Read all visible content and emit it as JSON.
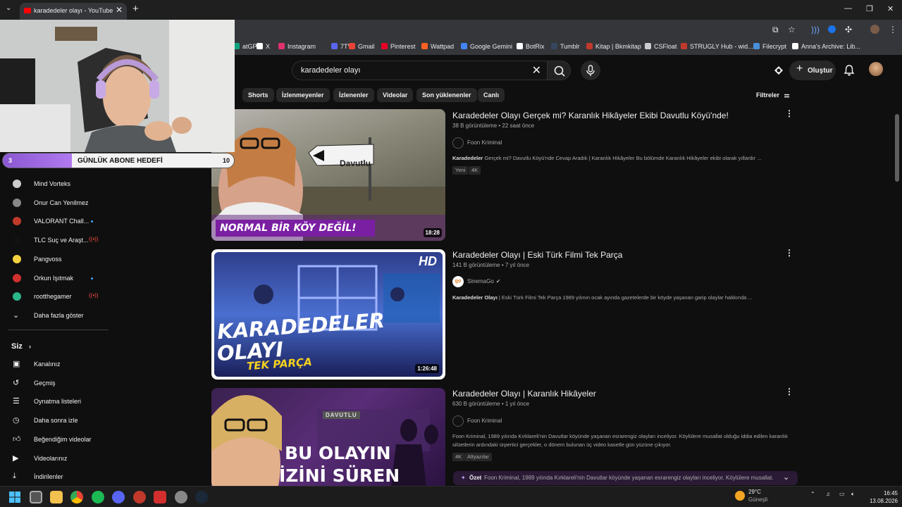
{
  "browser": {
    "tab_title": "karadedeler olayı - YouTube",
    "new_tab": "+",
    "close_tab": "✕",
    "bookmarks": [
      "atGPT",
      "X",
      "Instagram",
      "7TV",
      "Gmail",
      "Pinterest",
      "Wattpad",
      "Google Gemini",
      "BotRix",
      "Tumblr",
      "Kitap | Bkmkitap",
      "CSFloat",
      "STRUGLY Hub - wid...",
      "Filecrypt",
      "Anna's Archive: Lib..."
    ],
    "bookmark_colors": [
      "#10a37f",
      "#ffffff",
      "#e1306c",
      "#5865f2",
      "#ea4335",
      "#e60023",
      "#ff6122",
      "#4285f4",
      "#ffffff",
      "#36465d",
      "#c0392b",
      "#cccccc",
      "#c0392b",
      "#4a90d9",
      "#ffffff"
    ]
  },
  "youtube": {
    "search_value": "karadedeler olayı",
    "create_label": "Oluştur",
    "filters_label": "Filtreler",
    "chips": [
      "Shorts",
      "İzlenmeyenler",
      "İzlenenler",
      "Videolar",
      "Son yüklenenler",
      "Canlı"
    ],
    "subscriptions": [
      {
        "name": "Mind Vorteks",
        "color": "#cccccc",
        "marker": ""
      },
      {
        "name": "Onur Can Yenilmez",
        "color": "#888888",
        "marker": ""
      },
      {
        "name": "VALORANT Chall...",
        "color": "#c0392b",
        "marker": "dot"
      },
      {
        "name": "TLC Suç ve Araşt...",
        "color": "#111111",
        "marker": "live"
      },
      {
        "name": "Pangvoss",
        "color": "#f5d142",
        "marker": ""
      },
      {
        "name": "Orkun Işıtmak",
        "color": "#d0312d",
        "marker": "dot"
      },
      {
        "name": "rootthegamer",
        "color": "#2bb58a",
        "marker": "live"
      }
    ],
    "show_more": "Daha fazla göster",
    "you_section": "Siz",
    "you_items": [
      "Kanalınız",
      "Geçmiş",
      "Oynatma listeleri",
      "Daha sonra izle",
      "Beğendiğim videolar",
      "Videolarınız",
      "İndirilenler"
    ],
    "videos": [
      {
        "title": "Karadedeler Olayı Gerçek mi? Karanlık Hikâyeler Ekibi Davutlu Köyü'nde!",
        "meta": "38 B görüntüleme • 22 saat önce",
        "channel": "Foon Kriminal",
        "desc_bold": "Karadedeler",
        "desc": " Gerçek mi? Davutlu Köyü'nde Cevap Aradık | Karanlık Hikâyeler Bu bölümde Karanlık Hikâyeler ekibi olarak yıllardır ...",
        "badges": [
          "Yeni",
          "4K"
        ],
        "duration": "18:28",
        "thumb_caption": "NORMAL BİR KÖY DEĞİL!",
        "sign": "Davutlu"
      },
      {
        "title": "Karadedeler Olayı | Eski Türk Filmi Tek Parça",
        "meta": "141 B görüntüleme • 7 yıl önce",
        "channel": "SinemaGo",
        "desc_bold": "Karadedeler Olayı",
        "desc": " | Eski Türk Filmi Tek Parça 1989 yılının ocak ayında gazetelerde bir köyde yaşanan garip olaylar hakkında ...",
        "badges": [],
        "duration": "1:26:48",
        "thumb_line1": "KARADEDELER",
        "thumb_line2": "OLAYI",
        "thumb_line3": "TEK PARÇA",
        "thumb_hd": "HD"
      },
      {
        "title": "Karadedeler Olayı | Karanlık Hikâyeler",
        "meta": "630 B görüntüleme • 1 yıl önce",
        "channel": "Foon Kriminal",
        "desc_bold": "",
        "desc": "Foon Kriminal, 1989 yılında Kırklareli'nin Davutlar köyünde yaşanan esrarengiz olayları inceliyor. Köylülere musallat olduğu iddia edilen karanlık silüetlerin ardındaki ürpertici gerçekler, o dönem bulunan üç video kasetle gün yüzüne çıkıyor.",
        "badges": [
          "4K",
          "Altyazılar"
        ],
        "thumb_line1": "BU OLAYIN",
        "thumb_line2": "İZİNİ SÜREN",
        "sign": "DAVUTLU",
        "summary_label": "Özet",
        "summary_text": "Foon Kriminal, 1989 yılında Kırklareli'nin Davutlar köyünde yaşanan esrarengiz olayları inceliyor. Köylülere musallat..."
      }
    ]
  },
  "overlay": {
    "goal_title": "GÜNLÜK ABONE HEDEFİ",
    "goal_current": "3",
    "goal_max": "10",
    "goal_progress": 0.3
  },
  "taskbar": {
    "weather_temp": "29°C",
    "weather_desc": "Güneşli",
    "time": "16:45",
    "date": "13.08.2026"
  }
}
